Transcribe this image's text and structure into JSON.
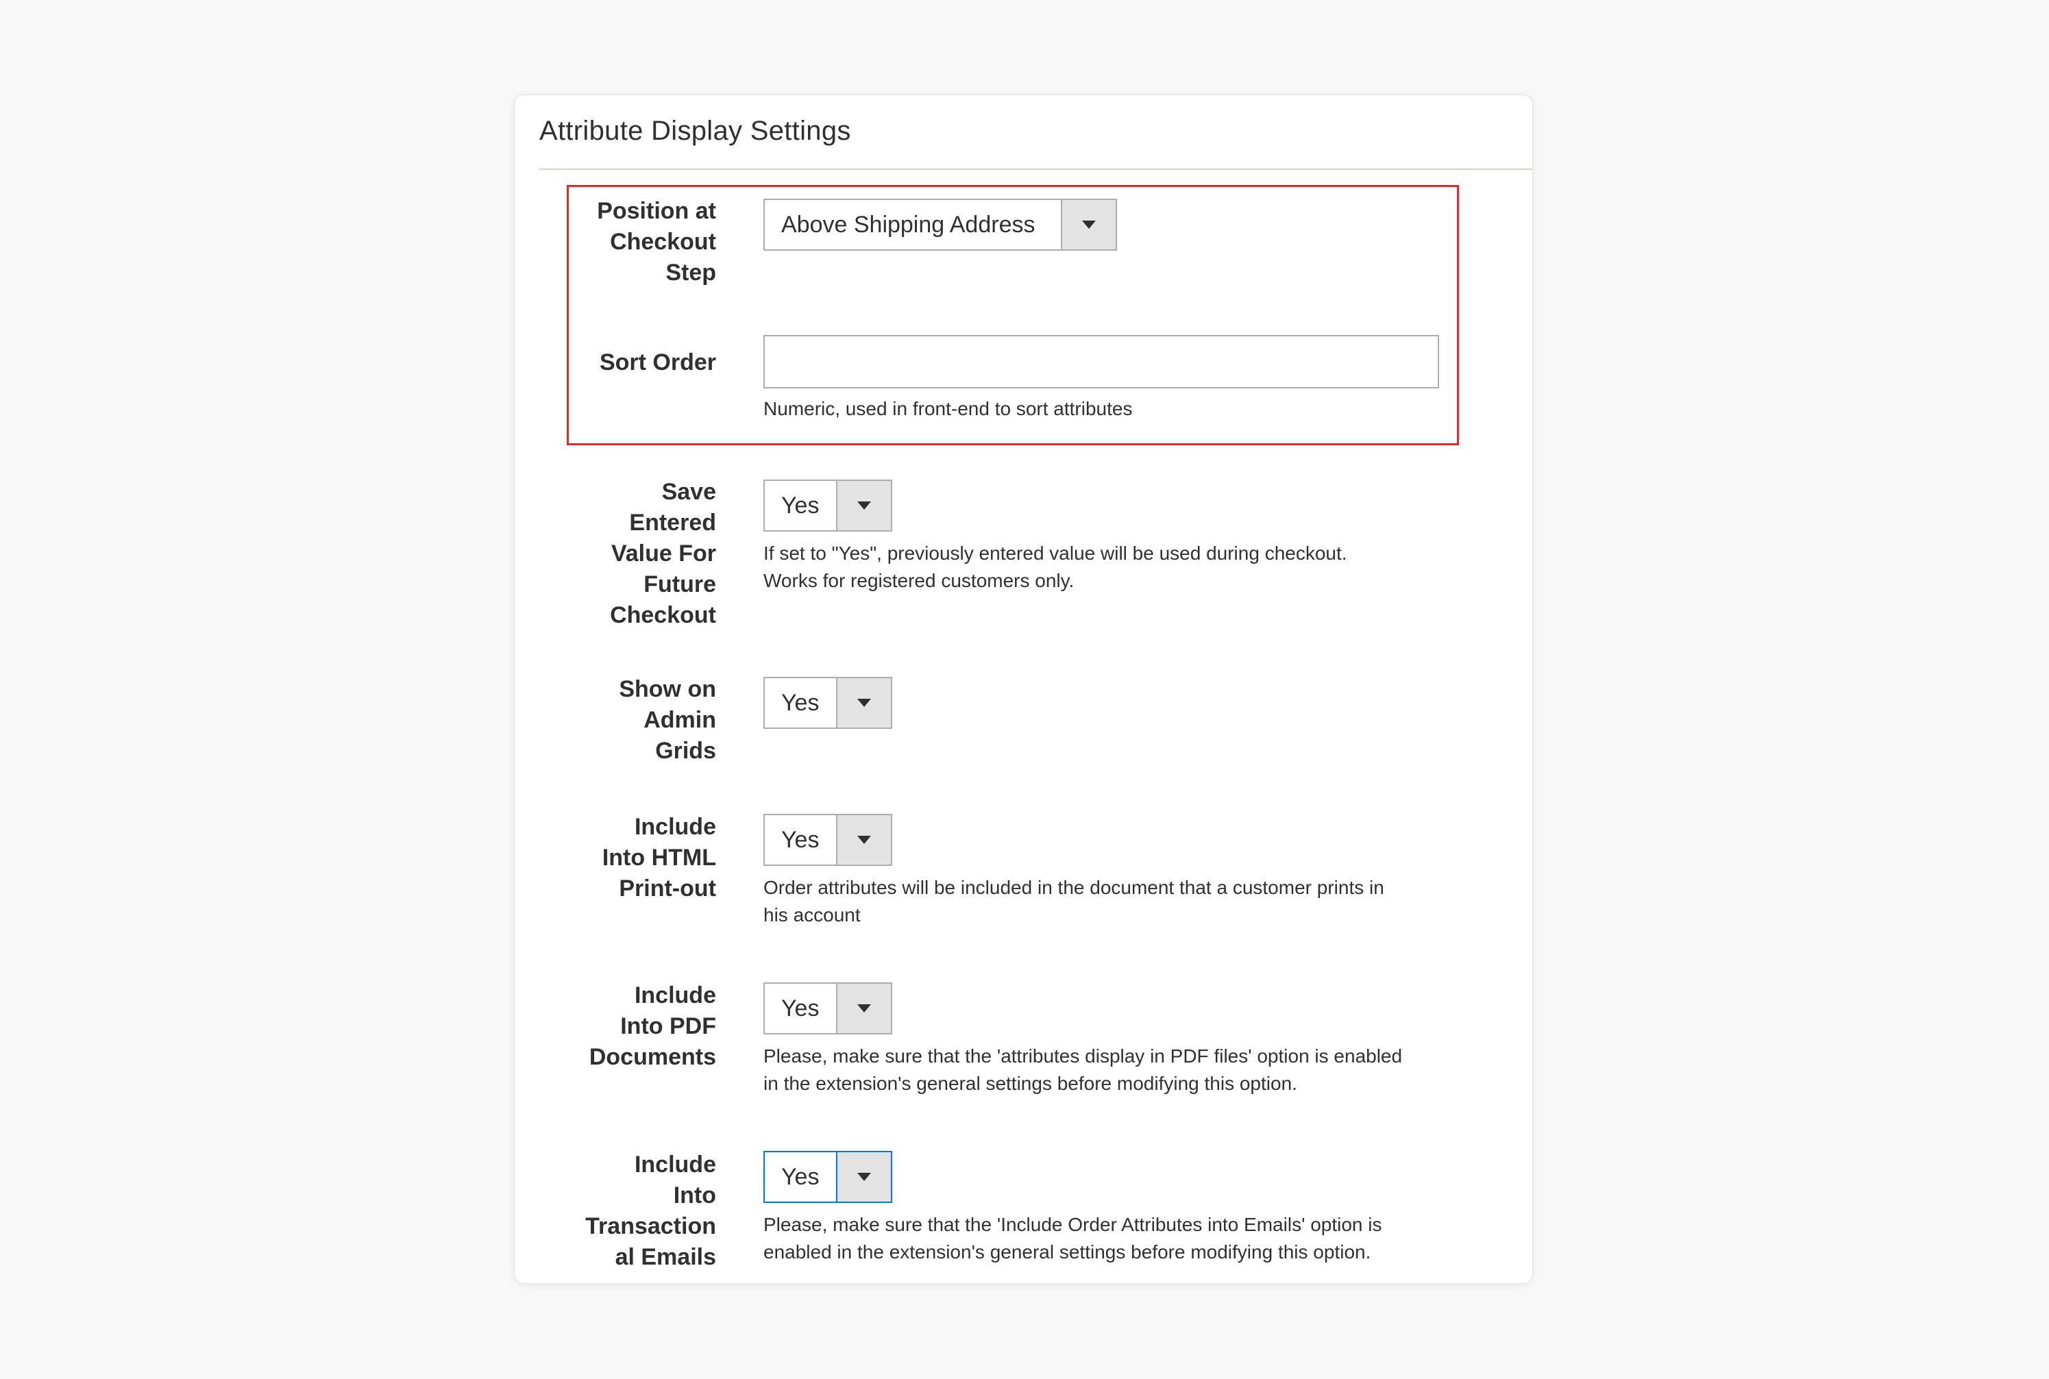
{
  "section": {
    "title": "Attribute Display Settings"
  },
  "fields": {
    "position": {
      "label_lines": [
        "Position at",
        "Checkout",
        "Step"
      ],
      "value": "Above Shipping Address"
    },
    "sort_order": {
      "label": "Sort Order",
      "value": "",
      "placeholder": "",
      "note": "Numeric, used in front-end to sort attributes"
    },
    "save_entered_value": {
      "label_lines": [
        "Save",
        "Entered",
        "Value For",
        "Future",
        "Checkout"
      ],
      "value": "Yes",
      "note_lines": [
        "If set to \"Yes\", previously entered value will be used during checkout.",
        "Works for registered customers only."
      ]
    },
    "show_on_admin_grids": {
      "label_lines": [
        "Show on",
        "Admin",
        "Grids"
      ],
      "value": "Yes"
    },
    "include_html_printout": {
      "label_lines": [
        "Include",
        "Into HTML",
        "Print-out"
      ],
      "value": "Yes",
      "note_lines": [
        "Order attributes will be included in the document that a customer prints in",
        "his account"
      ]
    },
    "include_pdf_documents": {
      "label_lines": [
        "Include",
        "Into PDF",
        "Documents"
      ],
      "value": "Yes",
      "note_lines": [
        "Please, make sure that the 'attributes display in PDF files' option is enabled",
        "in the extension's general settings before modifying this option."
      ]
    },
    "include_transactional_emails": {
      "label_lines": [
        "Include",
        "Into",
        "Transaction",
        "al Emails"
      ],
      "value": "Yes",
      "note_lines": [
        "Please, make sure that the 'Include Order Attributes into Emails' option is",
        "enabled in the extension's general settings before modifying this option."
      ]
    }
  },
  "colors": {
    "highlight_border": "#e02b27",
    "focus_border": "#007bdb",
    "input_border": "#adadad",
    "arrow_bg": "#e3e3e3"
  },
  "icons": {
    "select_arrow": "chevron-down-icon"
  }
}
